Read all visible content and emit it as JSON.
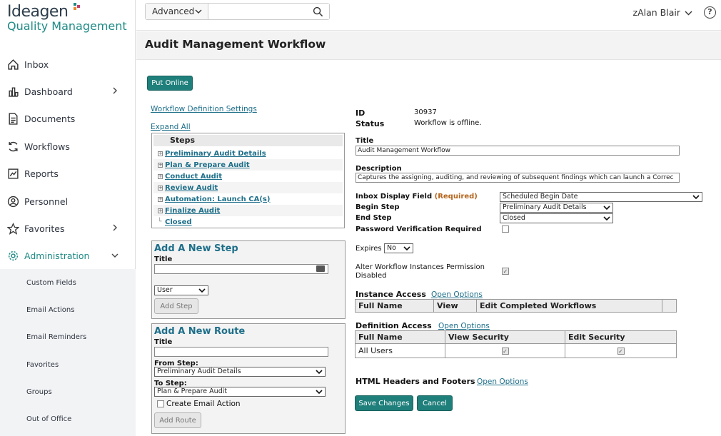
{
  "brand": {
    "name": "Ideagen",
    "product": "Quality Management"
  },
  "nav": [
    {
      "label": "Inbox",
      "icon": "home-icon"
    },
    {
      "label": "Dashboard",
      "icon": "chart-icon",
      "chev": true
    },
    {
      "label": "Documents",
      "icon": "document-icon"
    },
    {
      "label": "Workflows",
      "icon": "refresh-icon"
    },
    {
      "label": "Reports",
      "icon": "report-icon"
    },
    {
      "label": "Personnel",
      "icon": "person-icon"
    },
    {
      "label": "Favorites",
      "icon": "star-icon",
      "chev": true
    },
    {
      "label": "Administration",
      "icon": "gear-icon",
      "chev": true,
      "active": true
    }
  ],
  "subnav": [
    "Custom Fields",
    "Email Actions",
    "Email Reminders",
    "Favorites",
    "Groups",
    "Out of Office"
  ],
  "search": {
    "scope": "Advanced",
    "value": ""
  },
  "user": "zAlan Blair",
  "help": "?",
  "page_title": "Audit Management Workflow",
  "put_online": "Put Online",
  "wf_settings": "Workflow Definition Settings",
  "expand_all": "Expand All",
  "steps": {
    "header": "Steps",
    "items": [
      "Preliminary Audit Details",
      "Plan & Prepare Audit",
      "Conduct Audit",
      "Review Audit",
      "Automation: Launch CA(s)",
      "Finalize Audit",
      "Closed"
    ]
  },
  "add_step": {
    "title": "Add A New Step",
    "title_label": "Title",
    "type": "User",
    "button": "Add Step"
  },
  "add_route": {
    "title": "Add A New Route",
    "title_label": "Title",
    "from_label": "From Step:",
    "from_value": "Preliminary Audit Details",
    "to_label": "To Step:",
    "to_value": "Plan & Prepare Audit",
    "email_label": "Create Email Action",
    "button": "Add Route"
  },
  "details": {
    "id_label": "ID",
    "id": "30937",
    "status_label": "Status",
    "status": "Workflow is offline.",
    "title_label": "Title",
    "title": "Audit Management Workflow",
    "desc_label": "Description",
    "desc": "Captures the assigning, auditing, and reviewing of subsequent findings which can launch a Correc",
    "inbox_label": "Inbox Display Field",
    "required": "(Required)",
    "inbox_value": "Scheduled Begin Date",
    "begin_label": "Begin Step",
    "begin_value": "Preliminary Audit Details",
    "end_label": "End Step",
    "end_value": "Closed",
    "pwd_label": "Password Verification Required",
    "expires_label": "Expires",
    "expires_value": "No",
    "alter_label_1": "Alter Workflow Instances Permission",
    "alter_label_2": "Disabled",
    "instance_label": "Instance Access",
    "open_options": "Open Options",
    "instance_cols": [
      "Full Name",
      "View",
      "Edit Completed Workflows"
    ],
    "def_label": "Definition Access",
    "def_cols": [
      "Full Name",
      "View Security",
      "Edit Security"
    ],
    "def_row": "All Users",
    "html_label": "HTML Headers and Footers"
  },
  "save": "Save Changes",
  "cancel": "Cancel"
}
